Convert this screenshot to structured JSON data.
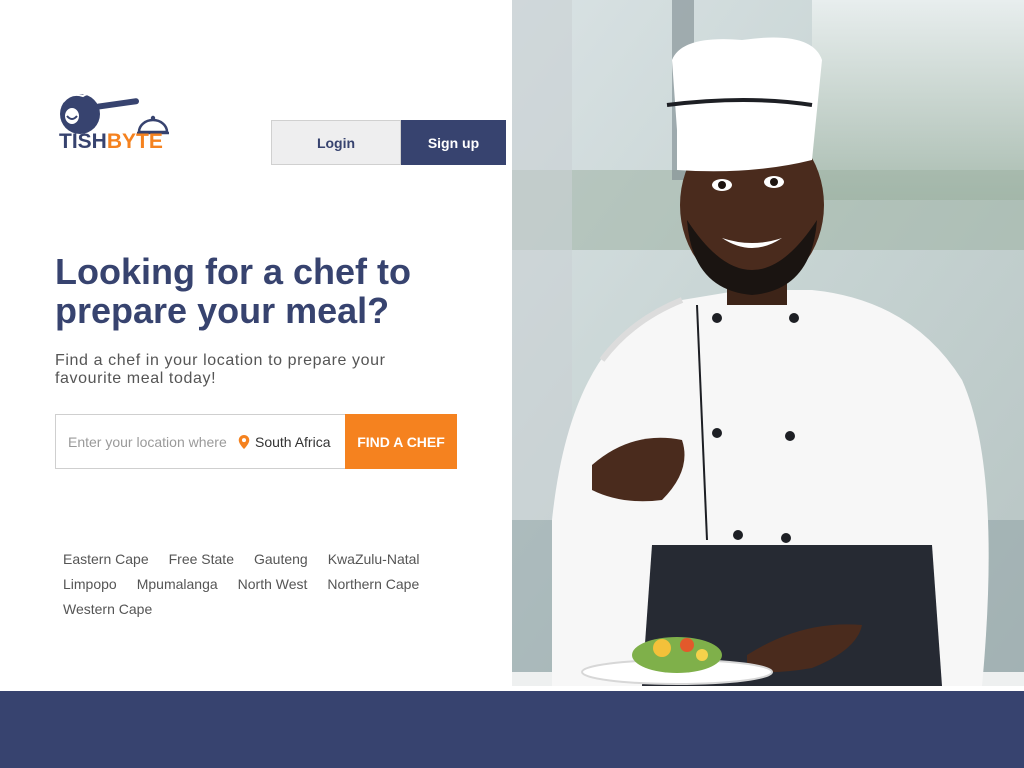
{
  "brand": {
    "part1": "TISH",
    "part2": "BYTE",
    "primary_color": "#37436f",
    "accent_color": "#f5821f"
  },
  "auth": {
    "login_label": "Login",
    "signup_label": "Sign up"
  },
  "hero": {
    "headline": "Looking for a chef to prepare your meal?",
    "subline": "Find a chef in your location to prepare your favourite meal today!",
    "image_alt": "chef"
  },
  "search": {
    "placeholder": "Enter your location where you need a chef",
    "country_icon": "location-pin-icon",
    "country": "South Africa",
    "button_label": "FIND A CHEF"
  },
  "provinces": [
    "Eastern Cape",
    "Free State",
    "Gauteng",
    "KwaZulu-Natal",
    "Limpopo",
    "Mpumalanga",
    "North West",
    "Northern Cape",
    "Western Cape"
  ]
}
